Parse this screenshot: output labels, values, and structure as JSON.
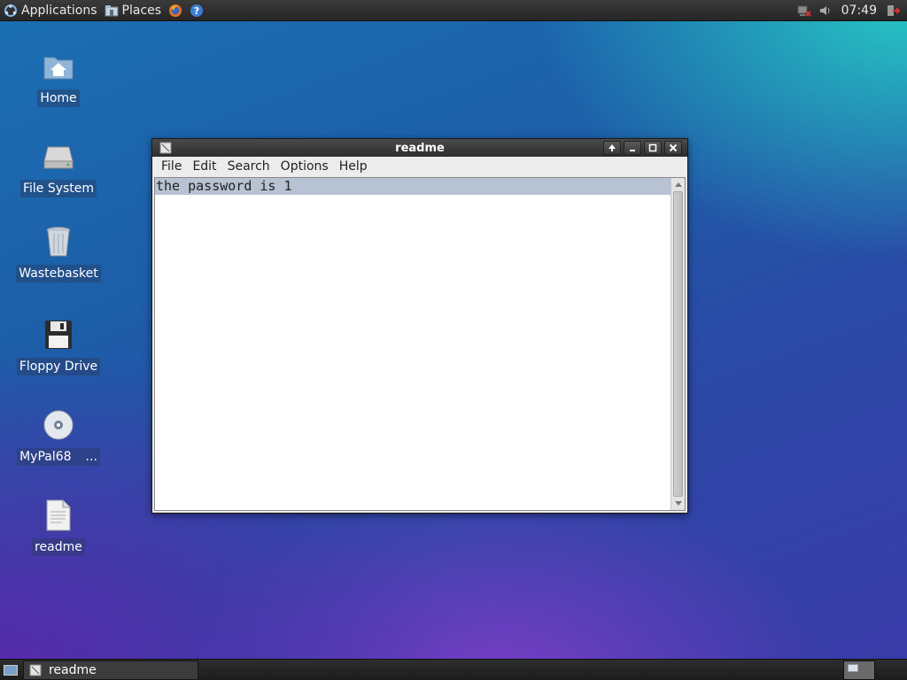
{
  "top_panel": {
    "applications_label": "Applications",
    "places_label": "Places",
    "clock": "07:49",
    "icons": [
      "app-menu-icon",
      "places-icon",
      "firefox-icon",
      "help-icon",
      "network-icon",
      "volume-icon",
      "logout-icon"
    ]
  },
  "desktop": {
    "items": [
      {
        "label": "Home",
        "icon": "home-folder-icon"
      },
      {
        "label": "File System",
        "icon": "hard-drive-icon"
      },
      {
        "label": "Wastebasket",
        "icon": "trash-icon"
      },
      {
        "label": "Floppy Drive",
        "icon": "floppy-icon"
      },
      {
        "label": "MyPal68",
        "suffix": "...",
        "icon": "optical-disc-icon"
      },
      {
        "label": "readme",
        "icon": "text-file-icon"
      }
    ]
  },
  "window": {
    "title": "readme",
    "menu": [
      "File",
      "Edit",
      "Search",
      "Options",
      "Help"
    ],
    "menu_mnemonic": [
      "F",
      "E",
      "S",
      "O",
      "H"
    ],
    "content_lines": [
      "the password is 1",
      ""
    ]
  },
  "taskbar": {
    "task_label": "readme"
  }
}
